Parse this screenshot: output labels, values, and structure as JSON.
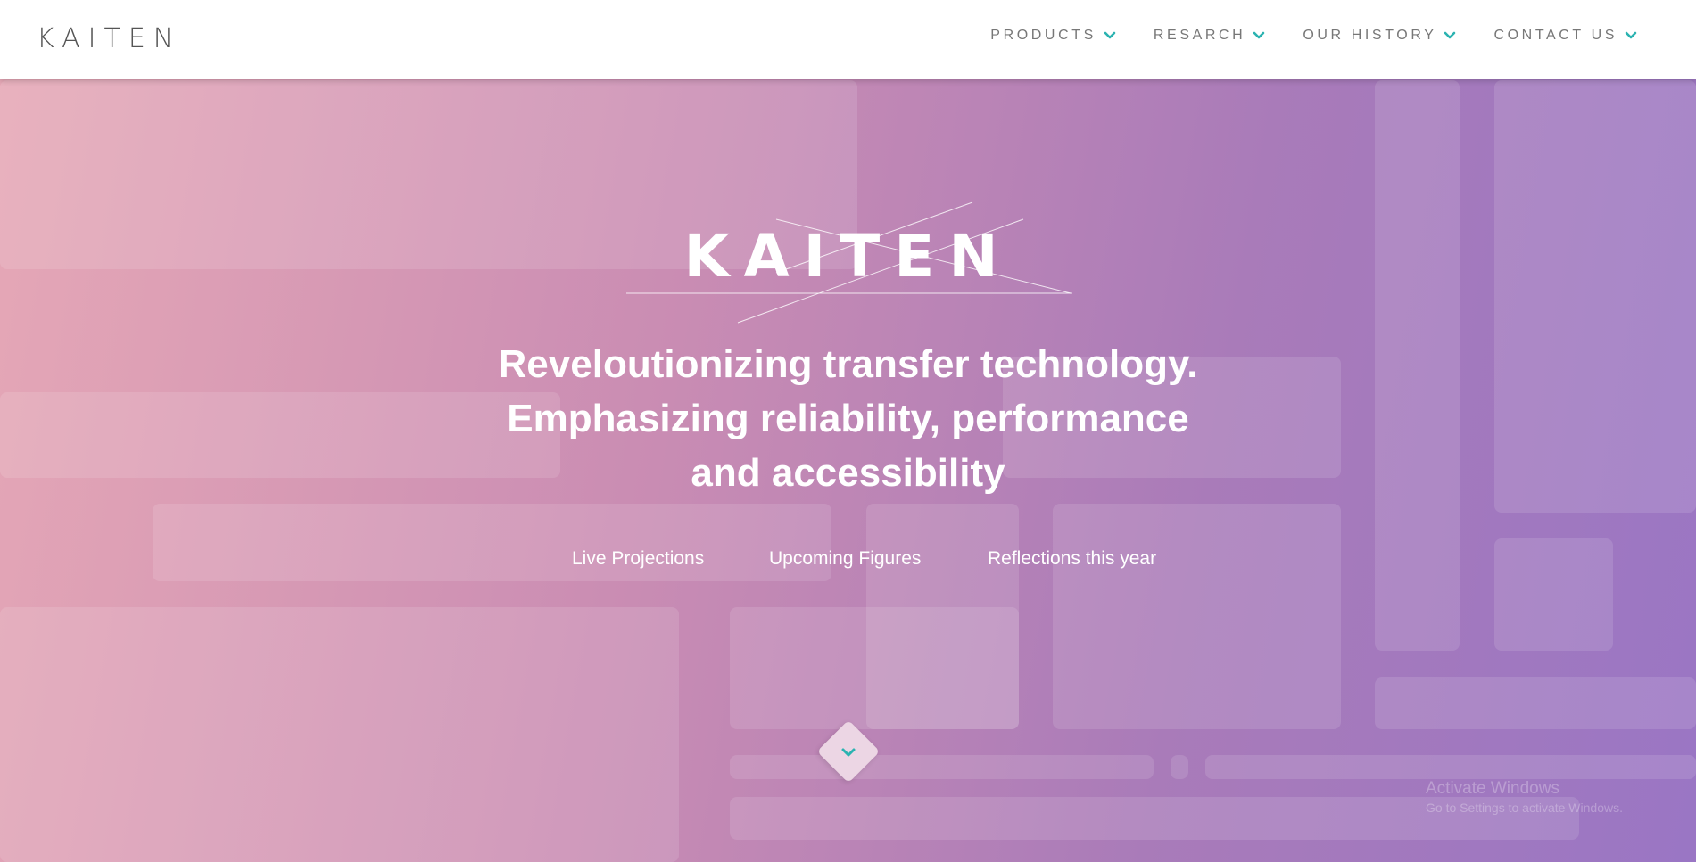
{
  "nav": {
    "logo": "KAITEN",
    "items": [
      {
        "label": "PRODUCTS"
      },
      {
        "label": "RESARCH"
      },
      {
        "label": "OUR HISTORY"
      },
      {
        "label": "CONTACT US"
      }
    ]
  },
  "hero": {
    "brand": "KAITEN",
    "tagline_lines": [
      "Reveloutionizing transfer technology.",
      "Emphasizing reliability, performance",
      "and accessibility"
    ],
    "links": [
      "Live Projections",
      "Upcoming Figures",
      "Reflections this year"
    ]
  },
  "watermark": {
    "title": "Activate Windows",
    "subtitle": "Go to Settings to activate Windows."
  },
  "colors": {
    "accent": "#2bb3b1",
    "gradient_start": "#e6a8b6",
    "gradient_end": "#9a76c4"
  },
  "icons": {
    "nav_chevron": "chevron-down-icon",
    "scroll": "chevron-down-icon"
  }
}
